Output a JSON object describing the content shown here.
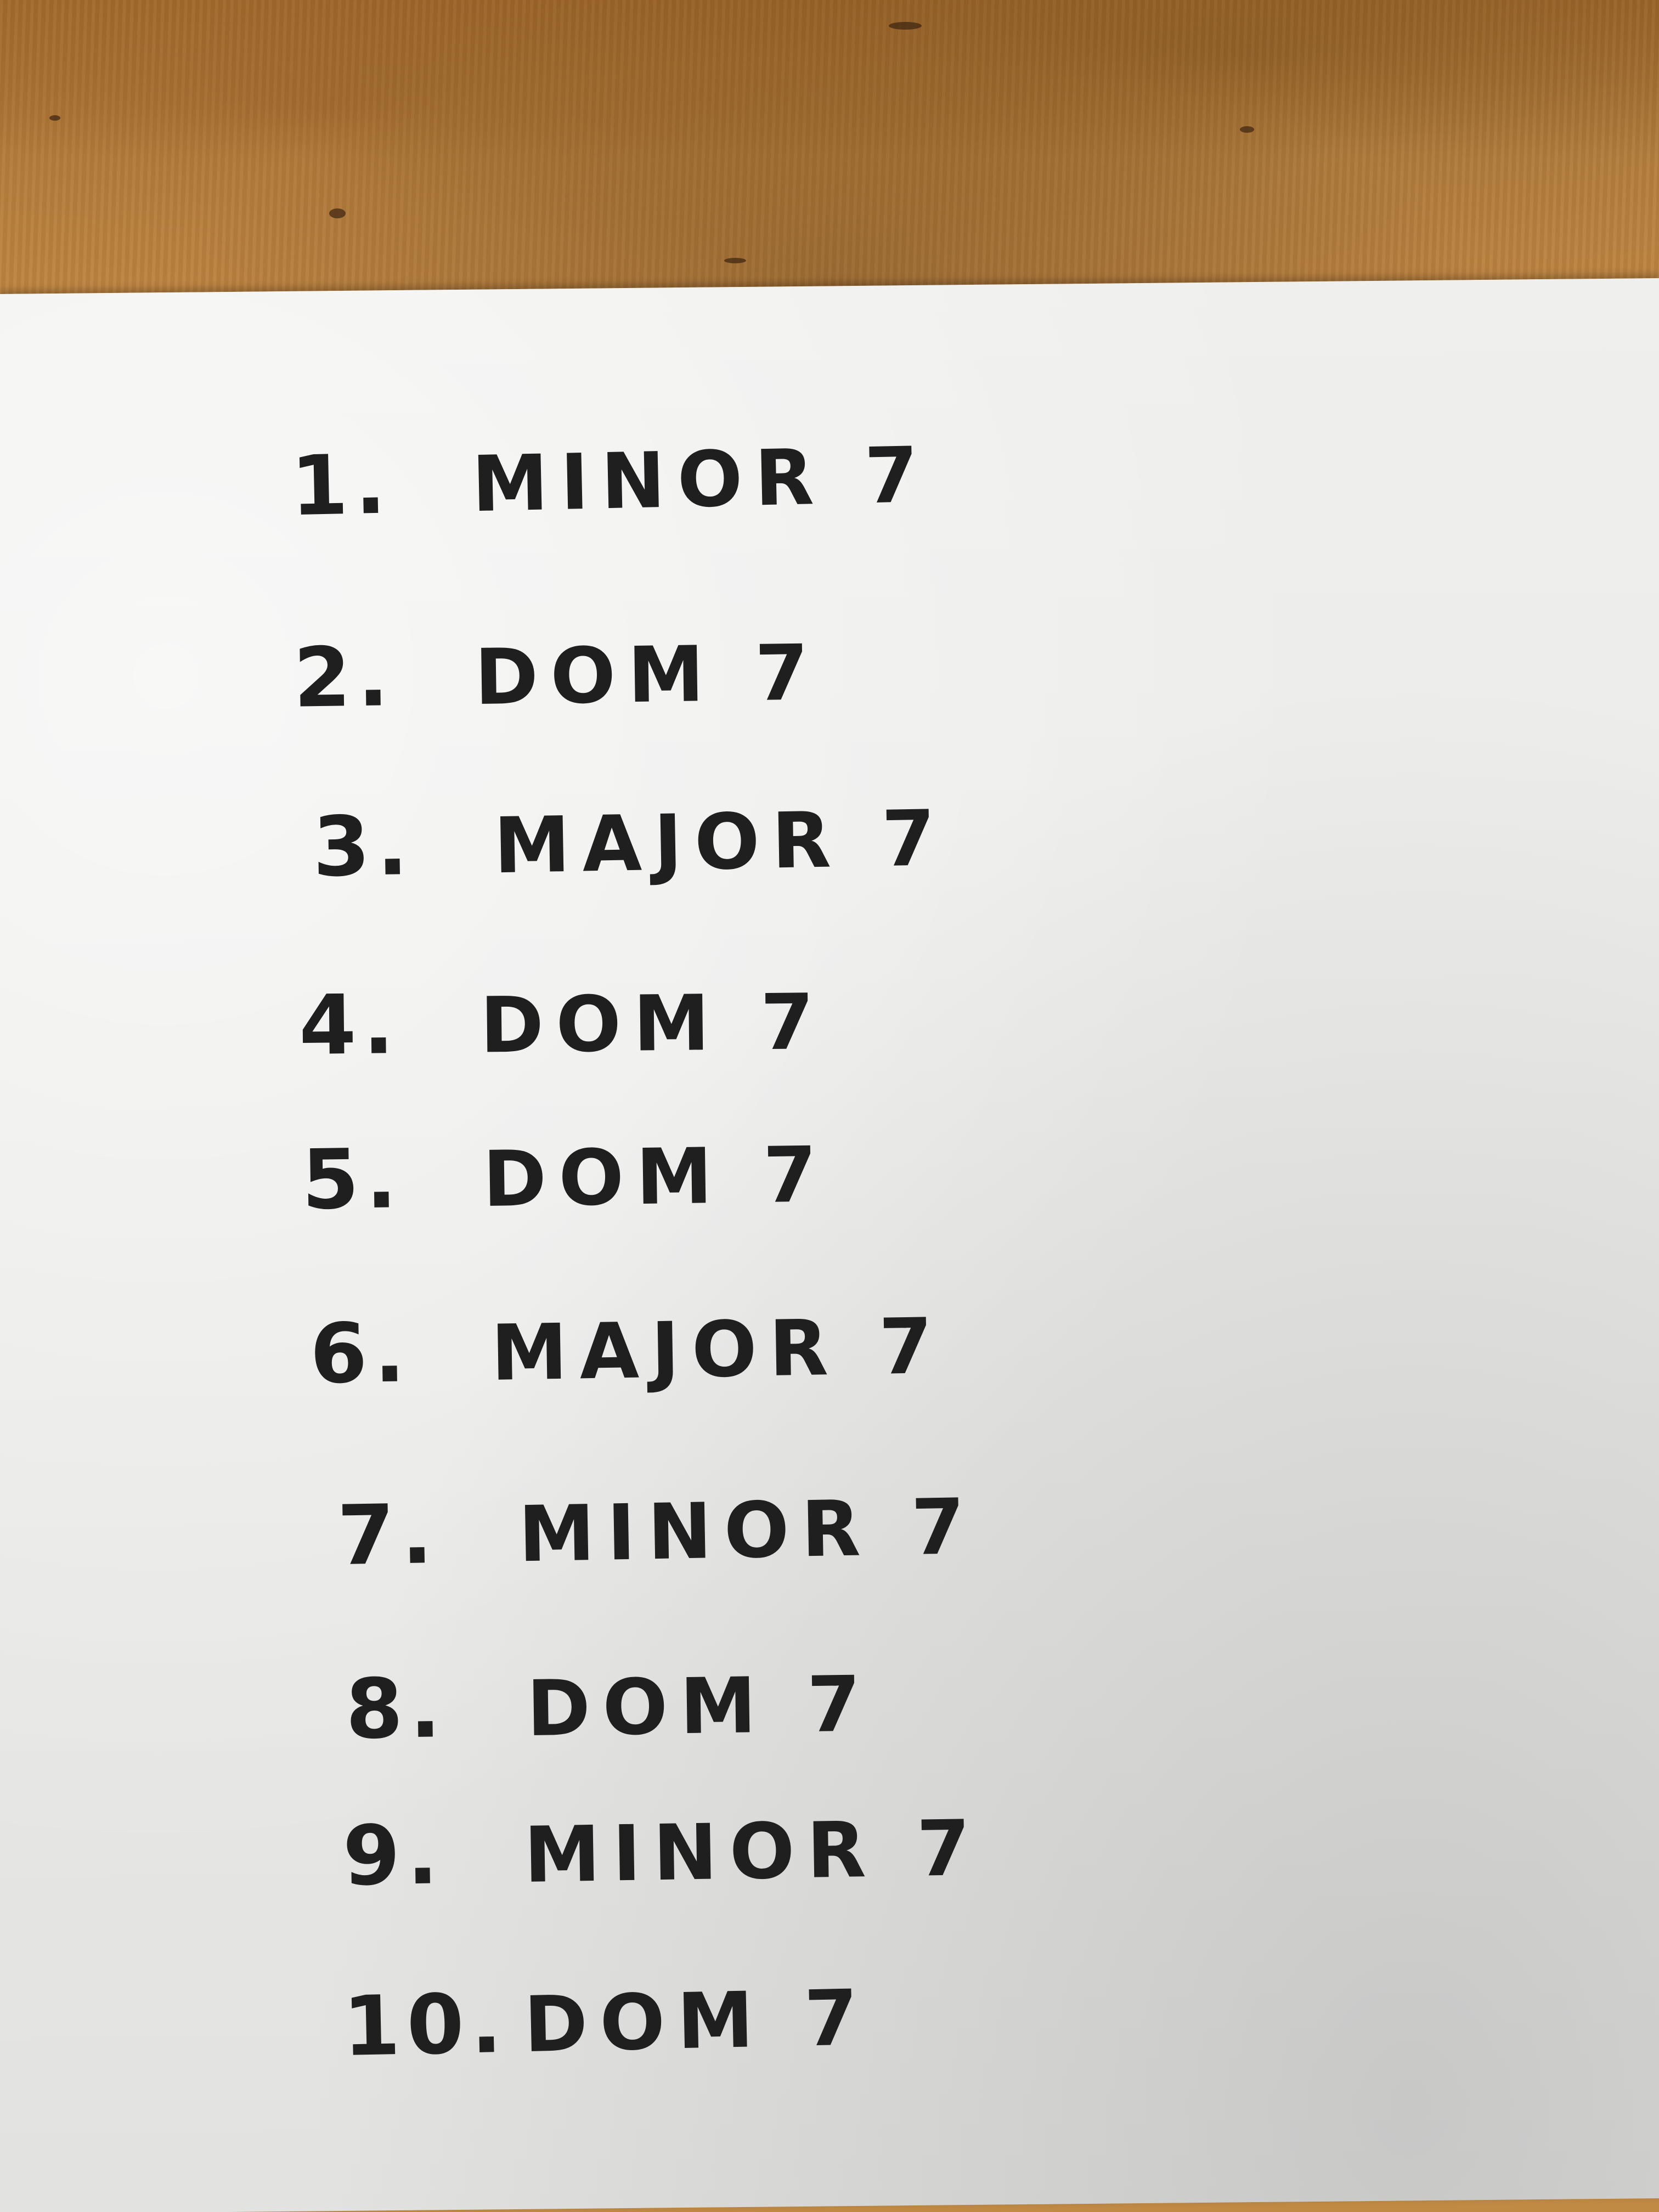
{
  "photo": {
    "desk_color": "#c08a45",
    "paper_color": "#ececea",
    "ink_color": "#1f1f1f"
  },
  "list": {
    "items": [
      {
        "number": "1.",
        "chord": "MINOR 7"
      },
      {
        "number": "2.",
        "chord": "DOM 7"
      },
      {
        "number": "3.",
        "chord": "MAJOR 7"
      },
      {
        "number": "4.",
        "chord": "DOM 7"
      },
      {
        "number": "5.",
        "chord": "DOM 7"
      },
      {
        "number": "6.",
        "chord": "MAJOR 7"
      },
      {
        "number": "7.",
        "chord": "MINOR 7"
      },
      {
        "number": "8.",
        "chord": "DOM 7"
      },
      {
        "number": "9.",
        "chord": "MINOR 7"
      },
      {
        "number": "10.",
        "chord": "DOM 7"
      }
    ]
  }
}
